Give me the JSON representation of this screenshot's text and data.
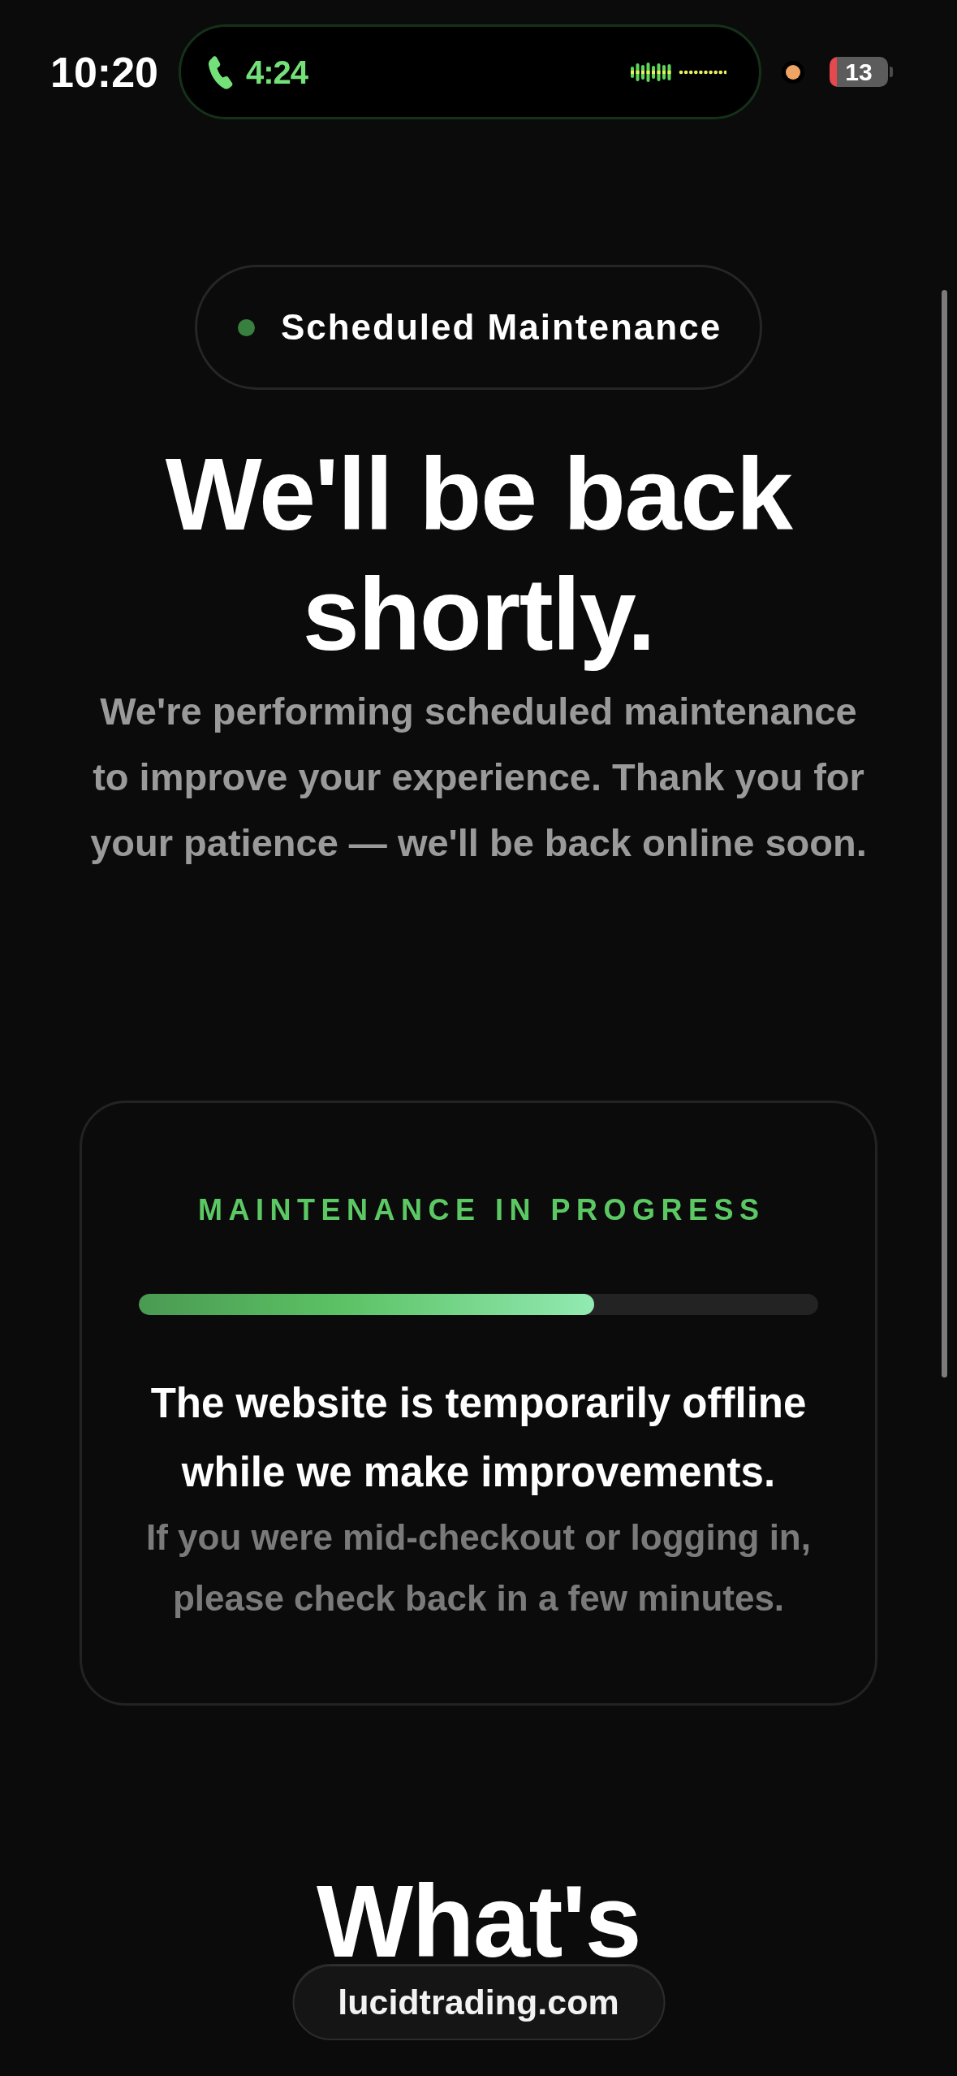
{
  "status_bar": {
    "time": "10:20",
    "call_timer": "4:24",
    "battery": "13"
  },
  "badge": {
    "label": "Scheduled Maintenance"
  },
  "hero": {
    "title": "We'll be back shortly.",
    "intro": "We're performing scheduled maintenance\nto improve your experience. Thank you for\nyour patience — we'll be back online soon."
  },
  "status_card": {
    "label": "MAINTENANCE IN PROGRESS",
    "progress": {
      "level": 0.67
    },
    "message": "The website is temporarily offline\nwhile we make improvements.",
    "note": "If you were mid-checkout or logging in,\nplease check back in a few minutes."
  },
  "next_section": {
    "title": "What's"
  },
  "address_bar": {
    "url": "lucidtrading.com"
  }
}
